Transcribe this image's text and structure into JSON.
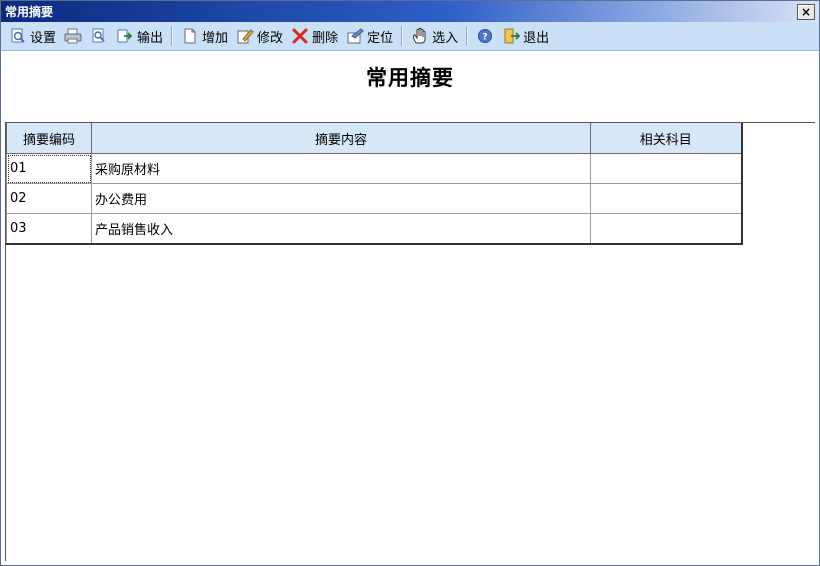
{
  "window": {
    "title": "常用摘要",
    "close_label": "×"
  },
  "toolbar": {
    "items": [
      {
        "name": "settings",
        "label": "设置",
        "icon": "preview-settings-icon"
      },
      {
        "name": "print",
        "label": "",
        "icon": "printer-icon"
      },
      {
        "name": "preview",
        "label": "",
        "icon": "print-preview-icon"
      },
      {
        "name": "export",
        "label": "输出",
        "icon": "export-icon"
      },
      {
        "name": "add",
        "label": "增加",
        "icon": "new-doc-icon"
      },
      {
        "name": "edit",
        "label": "修改",
        "icon": "edit-icon"
      },
      {
        "name": "delete",
        "label": "删除",
        "icon": "delete-icon"
      },
      {
        "name": "locate",
        "label": "定位",
        "icon": "locate-icon"
      },
      {
        "name": "select",
        "label": "选入",
        "icon": "hand-icon"
      },
      {
        "name": "help",
        "label": "",
        "icon": "help-icon"
      },
      {
        "name": "exit",
        "label": "退出",
        "icon": "exit-icon"
      }
    ]
  },
  "heading": "常用摘要",
  "table": {
    "columns": [
      "摘要编码",
      "摘要内容",
      "相关科目"
    ],
    "rows": [
      {
        "code": "01",
        "content": "采购原材料",
        "subject": ""
      },
      {
        "code": "02",
        "content": "办公费用",
        "subject": ""
      },
      {
        "code": "03",
        "content": "产品销售收入",
        "subject": ""
      }
    ]
  }
}
